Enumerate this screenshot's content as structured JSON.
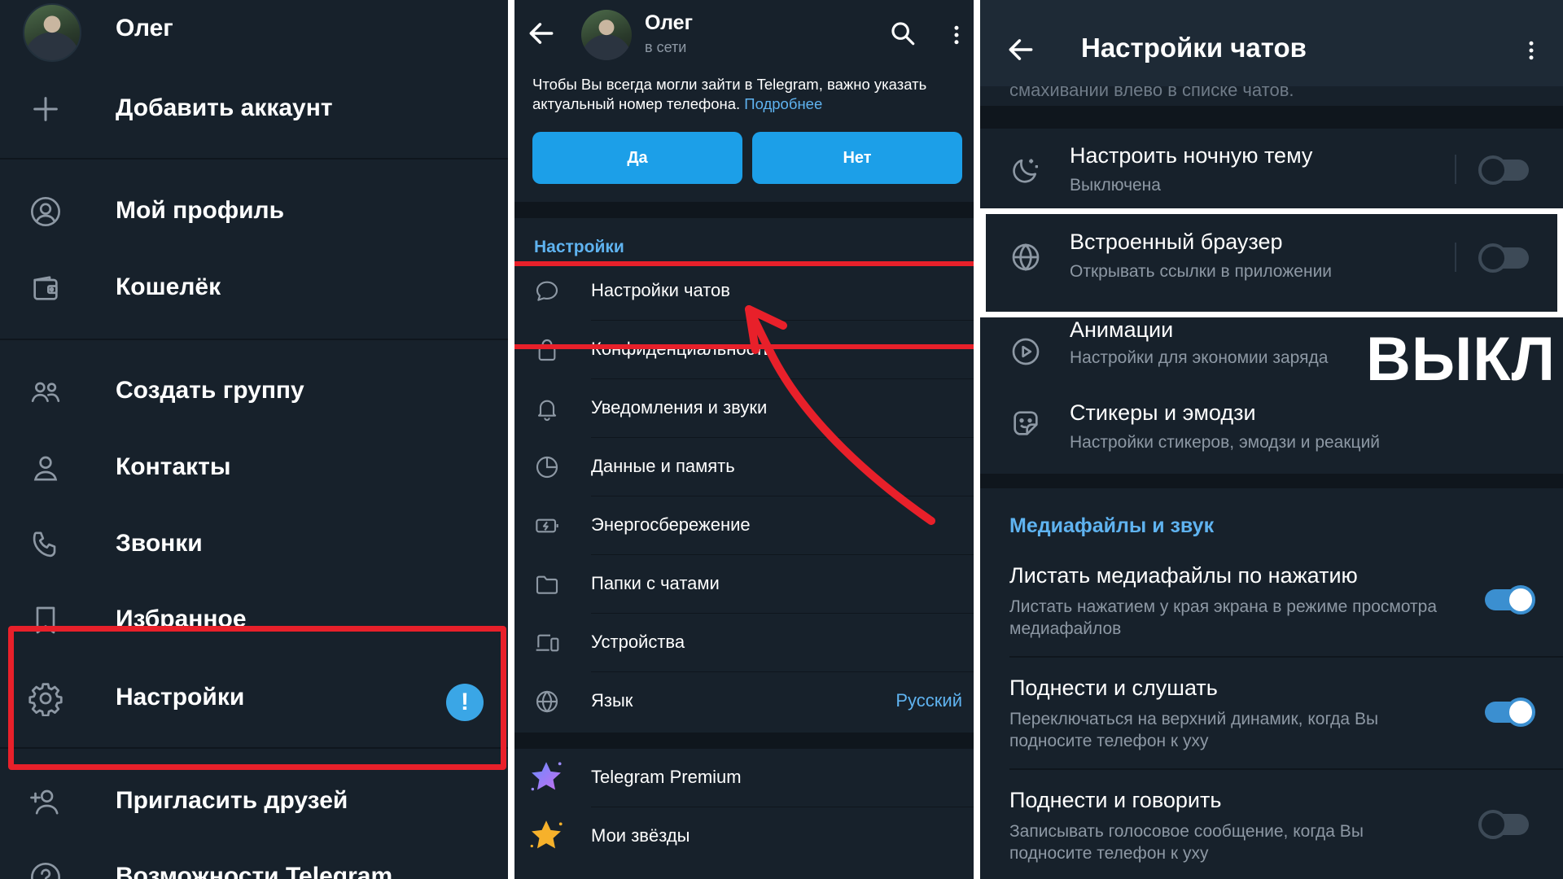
{
  "drawer": {
    "user_name": "Олег",
    "add_account": "Добавить аккаунт",
    "items": [
      {
        "label": "Мой профиль",
        "icon": "profile-icon"
      },
      {
        "label": "Кошелёк",
        "icon": "wallet-icon"
      },
      {
        "label": "Создать группу",
        "icon": "group-icon"
      },
      {
        "label": "Контакты",
        "icon": "contact-icon"
      },
      {
        "label": "Звонки",
        "icon": "phone-icon"
      },
      {
        "label": "Избранное",
        "icon": "bookmark-icon"
      },
      {
        "label": "Настройки",
        "icon": "gear-icon",
        "badge": "!"
      },
      {
        "label": "Пригласить друзей",
        "icon": "add-user-icon"
      },
      {
        "label": "Возможности Telegram",
        "icon": "help-icon"
      }
    ]
  },
  "settings": {
    "header": {
      "name": "Олег",
      "status": "в сети"
    },
    "notice": {
      "text": "Чтобы Вы всегда могли зайти в Telegram, важно указать актуальный номер телефона.",
      "link": "Подробнее"
    },
    "buttons": {
      "yes": "Да",
      "no": "Нет"
    },
    "section_title": "Настройки",
    "rows": [
      {
        "label": "Настройки чатов",
        "icon": "chat-bubble-icon"
      },
      {
        "label": "Конфиденциальность",
        "icon": "lock-icon"
      },
      {
        "label": "Уведомления и звуки",
        "icon": "bell-icon"
      },
      {
        "label": "Данные и память",
        "icon": "pie-chart-icon"
      },
      {
        "label": "Энергосбережение",
        "icon": "battery-icon"
      },
      {
        "label": "Папки с чатами",
        "icon": "folder-icon"
      },
      {
        "label": "Устройства",
        "icon": "devices-icon"
      },
      {
        "label": "Язык",
        "icon": "globe-icon",
        "value": "Русский"
      }
    ],
    "extra_rows": [
      {
        "label": "Telegram Premium",
        "icon": "premium-star-icon"
      },
      {
        "label": "Мои звёзды",
        "icon": "gold-star-icon"
      }
    ]
  },
  "chat_settings": {
    "title": "Настройки чатов",
    "cut_text": "смахивании влево в списке чатов.",
    "rows": [
      {
        "title": "Настроить ночную тему",
        "subtitle": "Выключена",
        "icon": "moon-icon",
        "toggle": false
      },
      {
        "title": "Встроенный браузер",
        "subtitle": "Открывать ссылки в приложении",
        "icon": "globe-icon",
        "toggle": false
      },
      {
        "title": "Анимации",
        "subtitle": "Настройки для экономии заряда",
        "icon": "play-icon"
      },
      {
        "title": "Стикеры и эмодзи",
        "subtitle": "Настройки стикеров, эмодзи и реакций",
        "icon": "sticker-icon"
      }
    ],
    "annotation": "ВЫКЛ",
    "media_section_title": "Медиафайлы и звук",
    "media_rows": [
      {
        "title": "Листать медиафайлы по нажатию",
        "subtitle": "Листать нажатием у края экрана в режиме просмотра медиафайлов",
        "toggle": true
      },
      {
        "title": "Поднести и слушать",
        "subtitle": "Переключаться на верхний динамик, когда Вы подносите телефон к уху",
        "toggle": true
      },
      {
        "title": "Поднести и говорить",
        "subtitle": "Записывать голосовое сообщение, когда Вы подносите телефон к уху",
        "toggle": false
      }
    ]
  },
  "colors": {
    "background": "#17212b",
    "accent": "#5fb3f0",
    "button": "#1c9fe8",
    "highlight_red": "#e8202a",
    "highlight_white": "#ffffff"
  }
}
